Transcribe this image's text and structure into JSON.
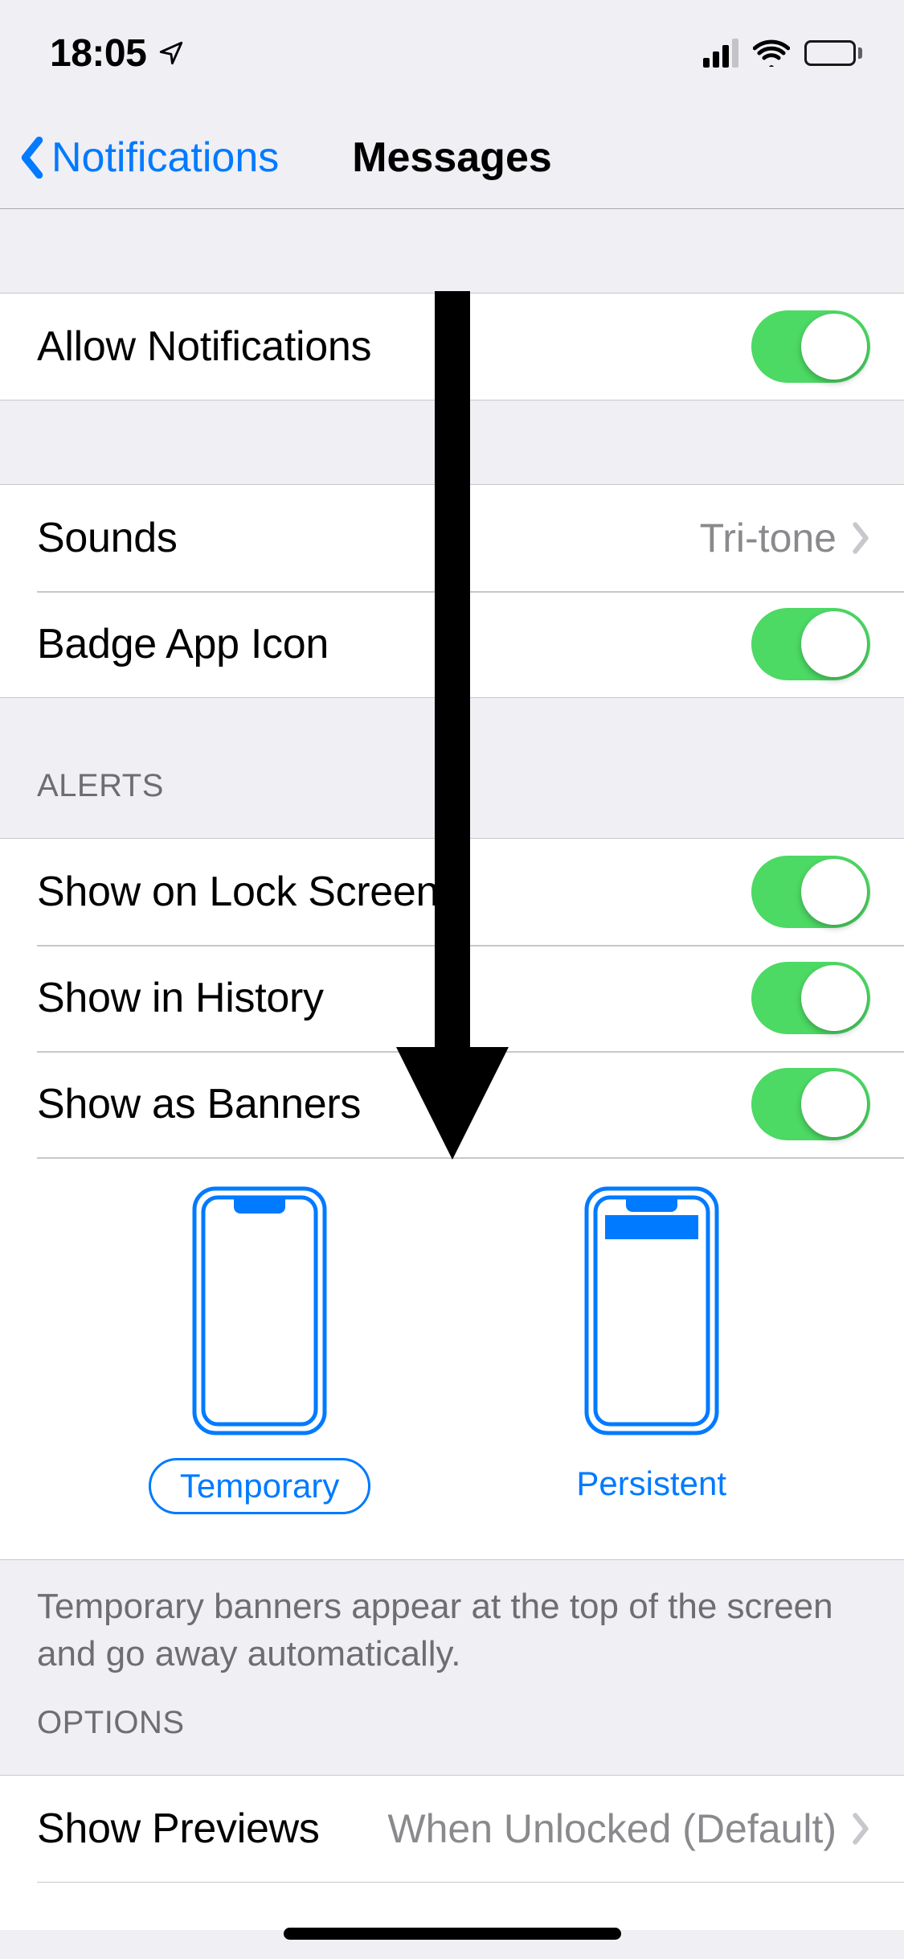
{
  "status": {
    "time": "18:05"
  },
  "nav": {
    "back": "Notifications",
    "title": "Messages"
  },
  "rows": {
    "allow": "Allow Notifications",
    "sounds": "Sounds",
    "sounds_value": "Tri-tone",
    "badge": "Badge App Icon",
    "lock": "Show on Lock Screen",
    "history": "Show in History",
    "banners": "Show as Banners",
    "previews": "Show Previews",
    "previews_value": "When Unlocked (Default)"
  },
  "sections": {
    "alerts": "ALERTS",
    "options": "OPTIONS"
  },
  "banner_style": {
    "temporary": "Temporary",
    "persistent": "Persistent",
    "footer": "Temporary banners appear at the top of the screen and go away automatically."
  }
}
